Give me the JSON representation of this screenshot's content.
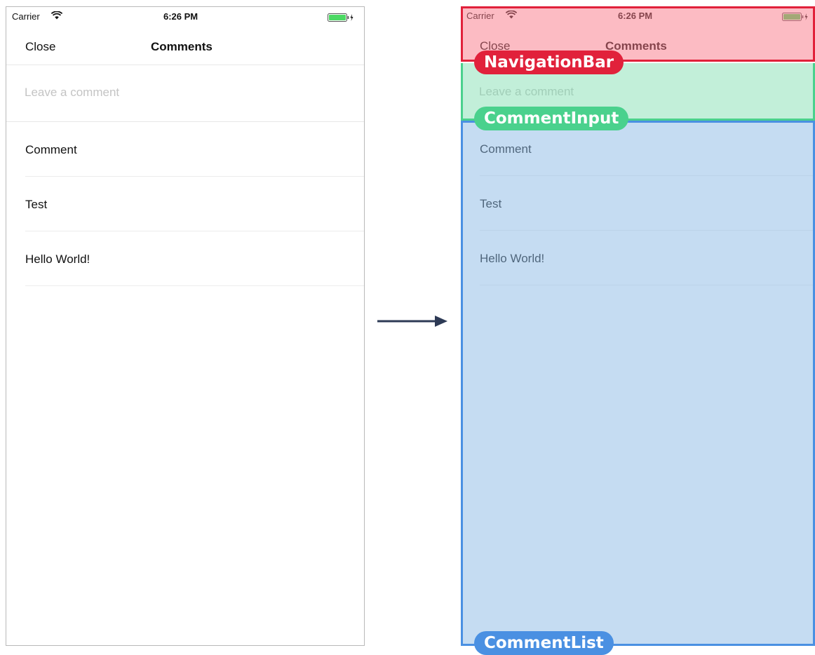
{
  "status_bar": {
    "carrier": "Carrier",
    "time": "6:26 PM"
  },
  "nav_bar": {
    "close_label": "Close",
    "title": "Comments"
  },
  "comment_input": {
    "placeholder": "Leave a comment"
  },
  "comments": [
    "Comment",
    "Test",
    "Hello World!"
  ],
  "labels": {
    "navigation_bar": "NavigationBar",
    "comment_input": "CommentInput",
    "comment_list": "CommentList"
  },
  "colors": {
    "navigation_bar": "#e1213b",
    "comment_input": "#4ad18d",
    "comment_list": "#4a90e2",
    "battery": "#4cd964",
    "arrow": "#2d3a55"
  }
}
